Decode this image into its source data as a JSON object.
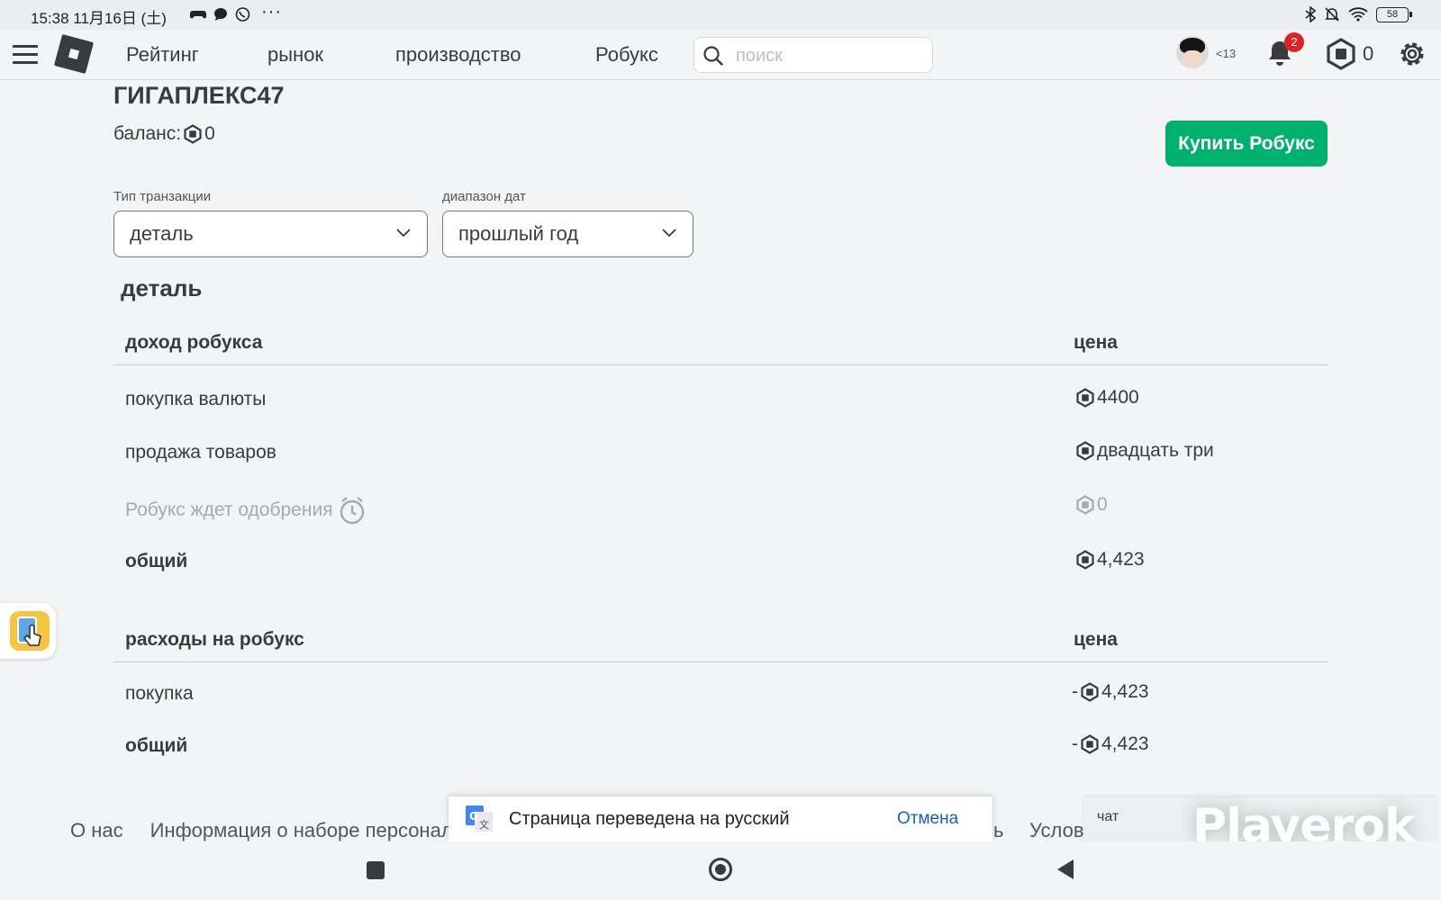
{
  "status_bar": {
    "time": "15:38 11月16日 (土)",
    "battery": "58",
    "icons": [
      "game-controller-icon",
      "chat-bubble-icon",
      "viber-icon"
    ],
    "right_icons": [
      "bluetooth-icon",
      "mute-icon",
      "wifi-icon",
      "battery-icon"
    ]
  },
  "nav": {
    "links": [
      "Рейтинг",
      "рынок",
      "производство",
      "Робукс"
    ],
    "search_placeholder": "поиск",
    "age_label": "<13",
    "notification_count": "2",
    "robux_balance": "0"
  },
  "account": {
    "username": "ГИГАПЛЕКС47",
    "balance_label": "баланс:",
    "balance_value": "0",
    "buy_button": "Купить Робукс"
  },
  "filters": {
    "transaction_type_label": "Тип транзакции",
    "transaction_type_value": "деталь",
    "date_range_label": "диапазон дат",
    "date_range_value": "прошлый год"
  },
  "section_title": "деталь",
  "income": {
    "header": "доход робукса",
    "price_header": "цена",
    "rows": [
      {
        "label": "покупка валюты",
        "value": "4400"
      },
      {
        "label": "продажа товаров",
        "value": "двадцать три"
      },
      {
        "label": "Робукс ждет одобрения",
        "value": "0"
      },
      {
        "label": "общий",
        "value": "4,423"
      }
    ]
  },
  "expenses": {
    "header": "расходы на робукс",
    "price_header": "цена",
    "rows": [
      {
        "label": "покупка",
        "value": "4,423",
        "sign": "-"
      },
      {
        "label": "общий",
        "value": "4,423",
        "sign": "-"
      }
    ]
  },
  "footer": {
    "about": "О нас",
    "personal_info": "Информация о наборе персонал",
    "partial_1": "ь",
    "partial_2": "Услов"
  },
  "translate_toast": {
    "message": "Страница переведена на русский",
    "undo": "Отмена"
  },
  "chat": {
    "label": "чат"
  },
  "watermark": "Playerok",
  "colors": {
    "buy_button": "#00b06f",
    "badge": "#d92424",
    "link_blue": "#1a5fb4"
  }
}
